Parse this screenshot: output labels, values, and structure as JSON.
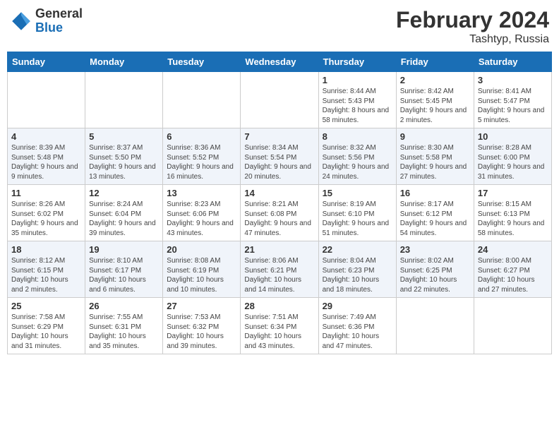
{
  "header": {
    "logo_general": "General",
    "logo_blue": "Blue",
    "month_year": "February 2024",
    "location": "Tashtyp, Russia"
  },
  "days_of_week": [
    "Sunday",
    "Monday",
    "Tuesday",
    "Wednesday",
    "Thursday",
    "Friday",
    "Saturday"
  ],
  "weeks": [
    [
      {
        "day": "",
        "info": ""
      },
      {
        "day": "",
        "info": ""
      },
      {
        "day": "",
        "info": ""
      },
      {
        "day": "",
        "info": ""
      },
      {
        "day": "1",
        "info": "Sunrise: 8:44 AM\nSunset: 5:43 PM\nDaylight: 8 hours and 58 minutes."
      },
      {
        "day": "2",
        "info": "Sunrise: 8:42 AM\nSunset: 5:45 PM\nDaylight: 9 hours and 2 minutes."
      },
      {
        "day": "3",
        "info": "Sunrise: 8:41 AM\nSunset: 5:47 PM\nDaylight: 9 hours and 5 minutes."
      }
    ],
    [
      {
        "day": "4",
        "info": "Sunrise: 8:39 AM\nSunset: 5:48 PM\nDaylight: 9 hours and 9 minutes."
      },
      {
        "day": "5",
        "info": "Sunrise: 8:37 AM\nSunset: 5:50 PM\nDaylight: 9 hours and 13 minutes."
      },
      {
        "day": "6",
        "info": "Sunrise: 8:36 AM\nSunset: 5:52 PM\nDaylight: 9 hours and 16 minutes."
      },
      {
        "day": "7",
        "info": "Sunrise: 8:34 AM\nSunset: 5:54 PM\nDaylight: 9 hours and 20 minutes."
      },
      {
        "day": "8",
        "info": "Sunrise: 8:32 AM\nSunset: 5:56 PM\nDaylight: 9 hours and 24 minutes."
      },
      {
        "day": "9",
        "info": "Sunrise: 8:30 AM\nSunset: 5:58 PM\nDaylight: 9 hours and 27 minutes."
      },
      {
        "day": "10",
        "info": "Sunrise: 8:28 AM\nSunset: 6:00 PM\nDaylight: 9 hours and 31 minutes."
      }
    ],
    [
      {
        "day": "11",
        "info": "Sunrise: 8:26 AM\nSunset: 6:02 PM\nDaylight: 9 hours and 35 minutes."
      },
      {
        "day": "12",
        "info": "Sunrise: 8:24 AM\nSunset: 6:04 PM\nDaylight: 9 hours and 39 minutes."
      },
      {
        "day": "13",
        "info": "Sunrise: 8:23 AM\nSunset: 6:06 PM\nDaylight: 9 hours and 43 minutes."
      },
      {
        "day": "14",
        "info": "Sunrise: 8:21 AM\nSunset: 6:08 PM\nDaylight: 9 hours and 47 minutes."
      },
      {
        "day": "15",
        "info": "Sunrise: 8:19 AM\nSunset: 6:10 PM\nDaylight: 9 hours and 51 minutes."
      },
      {
        "day": "16",
        "info": "Sunrise: 8:17 AM\nSunset: 6:12 PM\nDaylight: 9 hours and 54 minutes."
      },
      {
        "day": "17",
        "info": "Sunrise: 8:15 AM\nSunset: 6:13 PM\nDaylight: 9 hours and 58 minutes."
      }
    ],
    [
      {
        "day": "18",
        "info": "Sunrise: 8:12 AM\nSunset: 6:15 PM\nDaylight: 10 hours and 2 minutes."
      },
      {
        "day": "19",
        "info": "Sunrise: 8:10 AM\nSunset: 6:17 PM\nDaylight: 10 hours and 6 minutes."
      },
      {
        "day": "20",
        "info": "Sunrise: 8:08 AM\nSunset: 6:19 PM\nDaylight: 10 hours and 10 minutes."
      },
      {
        "day": "21",
        "info": "Sunrise: 8:06 AM\nSunset: 6:21 PM\nDaylight: 10 hours and 14 minutes."
      },
      {
        "day": "22",
        "info": "Sunrise: 8:04 AM\nSunset: 6:23 PM\nDaylight: 10 hours and 18 minutes."
      },
      {
        "day": "23",
        "info": "Sunrise: 8:02 AM\nSunset: 6:25 PM\nDaylight: 10 hours and 22 minutes."
      },
      {
        "day": "24",
        "info": "Sunrise: 8:00 AM\nSunset: 6:27 PM\nDaylight: 10 hours and 27 minutes."
      }
    ],
    [
      {
        "day": "25",
        "info": "Sunrise: 7:58 AM\nSunset: 6:29 PM\nDaylight: 10 hours and 31 minutes."
      },
      {
        "day": "26",
        "info": "Sunrise: 7:55 AM\nSunset: 6:31 PM\nDaylight: 10 hours and 35 minutes."
      },
      {
        "day": "27",
        "info": "Sunrise: 7:53 AM\nSunset: 6:32 PM\nDaylight: 10 hours and 39 minutes."
      },
      {
        "day": "28",
        "info": "Sunrise: 7:51 AM\nSunset: 6:34 PM\nDaylight: 10 hours and 43 minutes."
      },
      {
        "day": "29",
        "info": "Sunrise: 7:49 AM\nSunset: 6:36 PM\nDaylight: 10 hours and 47 minutes."
      },
      {
        "day": "",
        "info": ""
      },
      {
        "day": "",
        "info": ""
      }
    ]
  ]
}
